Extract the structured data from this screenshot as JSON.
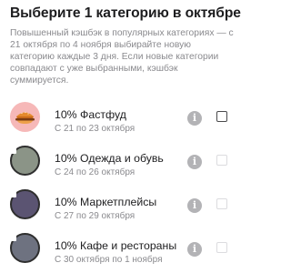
{
  "header": {
    "title": "Выберите 1 категорию в октябре",
    "description": "Повышенный кэшбэк в популярных категориях — с 21 октября по 4 ноября выбирайте новую категорию каждые 3 дня. Если новые категории совпадают с уже выбранными, кэшбэк суммируется."
  },
  "categories": [
    {
      "title": "10% Фастфуд",
      "dates": "С 21 по 23 октября",
      "icon": "burger-icon",
      "locked": false,
      "selectable": true
    },
    {
      "title": "10% Одежда и обувь",
      "dates": "С 24 по 26 октября",
      "icon": "lock-icon",
      "locked": true,
      "selectable": false
    },
    {
      "title": "10% Маркетплейсы",
      "dates": "С 27 по 29 октября",
      "icon": "lock-icon",
      "locked": true,
      "selectable": false
    },
    {
      "title": "10% Кафе и рестораны",
      "dates": "С 30 октября по 1 ноября",
      "icon": "lock-icon",
      "locked": true,
      "selectable": false
    }
  ],
  "info_icon": "i",
  "colors": {
    "food_avatar": "#f6b8b8",
    "info_badge": "#b3b3b6",
    "secondary_text": "#8a8a8e"
  }
}
